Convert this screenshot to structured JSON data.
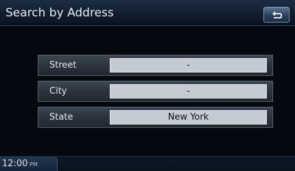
{
  "header": {
    "title": "Search by Address",
    "back_icon": "return-arrow-icon"
  },
  "form": {
    "fields": [
      {
        "label": "Street",
        "value": "-"
      },
      {
        "label": "City",
        "value": "-"
      },
      {
        "label": "State",
        "value": "New York"
      }
    ]
  },
  "status_bar": {
    "time": "12:00",
    "ampm": "PM"
  },
  "colors": {
    "background": "#05080d",
    "header": "#1d2f45",
    "field_row": "#2b333d",
    "value_box": "#c5cad3"
  }
}
